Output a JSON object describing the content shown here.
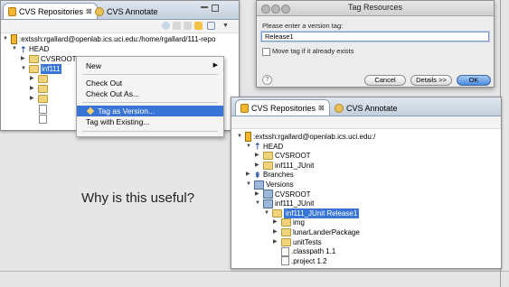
{
  "top_panel": {
    "tab_active": "CVS Repositories",
    "tab_close": "⊠",
    "tab_inactive": "CVS Annotate",
    "repo_path": ":extssh:rgallard@openlab.ics.uci.edu:/home/rgallard/111-repo",
    "head": "HEAD",
    "cvsroot": "CVSROOT",
    "inf_partial": "inf111"
  },
  "context_menu": {
    "items": [
      {
        "label": "New",
        "submenu": true
      },
      {
        "label": "Check Out"
      },
      {
        "label": "Check Out As..."
      },
      {
        "label": "Tag as Version...",
        "selected": true
      },
      {
        "label": "Tag with Existing..."
      }
    ]
  },
  "dialog": {
    "title": "Tag Resources",
    "prompt": "Please enter a version tag:",
    "tag_value": "Release1",
    "checkbox_label": "Move tag if it already exists",
    "checkbox_checked": false,
    "help": "?",
    "buttons": {
      "cancel": "Cancel",
      "details": "Details >>",
      "ok": "OK"
    }
  },
  "bottom_panel": {
    "tab_active": "CVS Repositories",
    "tab_close": "⊠",
    "tab_inactive": "CVS Annotate",
    "tree": [
      {
        "label": ":extssh:rgallard@openlab.ics.uci.edu:/",
        "icon": "repository-icon",
        "twisty": "open"
      },
      {
        "label": "HEAD",
        "icon": "head-branch-icon",
        "twisty": "open"
      },
      {
        "label": "CVSROOT",
        "icon": "folder-icon",
        "twisty": "closed"
      },
      {
        "label": "inf111_JUnit",
        "icon": "folder-icon",
        "twisty": "closed"
      },
      {
        "label": "Branches",
        "icon": "branches-icon",
        "twisty": "closed"
      },
      {
        "label": "Versions",
        "icon": "versions-icon",
        "twisty": "open"
      },
      {
        "label": "CVSROOT",
        "icon": "version-module-icon",
        "twisty": "closed"
      },
      {
        "label": "inf111_JUnit",
        "icon": "version-module-icon",
        "twisty": "open"
      },
      {
        "label": "inf111_JUnit Release1",
        "icon": "folder-icon",
        "twisty": "open",
        "selected": true
      },
      {
        "label": "img",
        "icon": "folder-icon",
        "twisty": "closed"
      },
      {
        "label": "lunarLanderPackage",
        "icon": "folder-icon",
        "twisty": "closed"
      },
      {
        "label": "unitTests",
        "icon": "folder-icon",
        "twisty": "closed"
      },
      {
        "label": ".classpath 1.1",
        "icon": "file-icon",
        "twisty": "none"
      },
      {
        "label": ".project 1.2",
        "icon": "file-icon",
        "twisty": "none"
      }
    ]
  },
  "caption": "Why is this useful?"
}
